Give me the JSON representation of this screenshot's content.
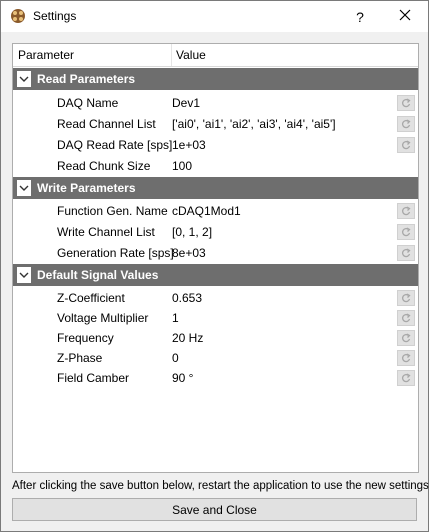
{
  "window": {
    "title": "Settings",
    "help_label": "?",
    "close_label": "✕"
  },
  "table": {
    "col_parameter": "Parameter",
    "col_value": "Value"
  },
  "groups": [
    {
      "label": "Read Parameters",
      "rows": [
        {
          "param": "DAQ Name",
          "value": "Dev1"
        },
        {
          "param": "Read Channel List",
          "value": "['ai0', 'ai1', 'ai2', 'ai3', 'ai4', 'ai5']"
        },
        {
          "param": "DAQ Read Rate [sps]",
          "value": "1e+03"
        },
        {
          "param": "Read Chunk Size",
          "value": "100"
        }
      ]
    },
    {
      "label": "Write Parameters",
      "rows": [
        {
          "param": "Function Gen. Name",
          "value": "cDAQ1Mod1"
        },
        {
          "param": "Write Channel List",
          "value": "[0, 1, 2]"
        },
        {
          "param": "Generation Rate [sps]",
          "value": "8e+03"
        }
      ]
    },
    {
      "label": "Default Signal Values",
      "rows": [
        {
          "param": "Z-Coefficient",
          "value": "0.653"
        },
        {
          "param": "Voltage Multiplier",
          "value": "1"
        },
        {
          "param": "Frequency",
          "value": "20 Hz"
        },
        {
          "param": "Z-Phase",
          "value": "0"
        },
        {
          "param": "Field Camber",
          "value": "90 °"
        }
      ]
    }
  ],
  "footer": {
    "info": "After clicking the save button below, restart the application to use the new settings!",
    "save_label": "Save and Close"
  },
  "colors": {
    "group_header_bg": "#6e6e6e",
    "window_bg": "#f0f0f0"
  }
}
